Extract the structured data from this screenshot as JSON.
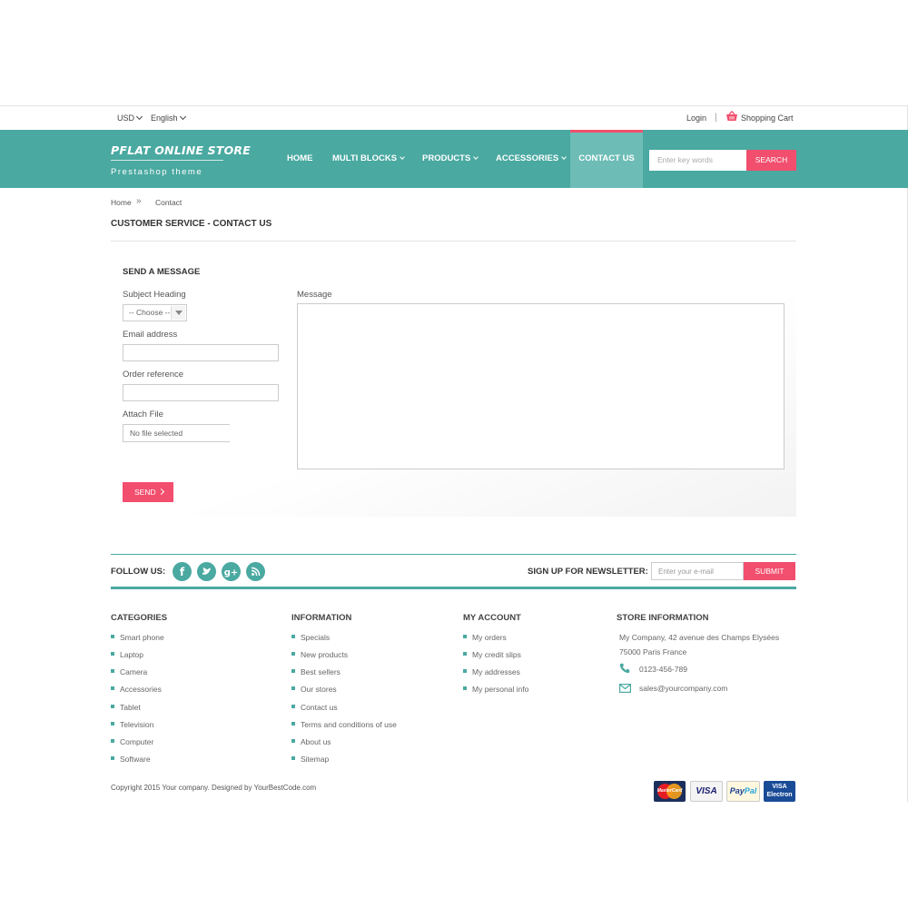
{
  "topbar": {
    "currency": "USD",
    "language": "English",
    "login": "Login",
    "separator": "|",
    "cart": "Shopping Cart"
  },
  "header": {
    "logo_title": "PFLAT ONLINE STORE",
    "logo_subtitle": "Prestashop theme",
    "nav": {
      "home": "HOME",
      "multi_blocks": "MULTI BLOCKS",
      "products": "PRODUCTS",
      "accessories": "ACCESSORIES",
      "contact_us": "CONTACT US"
    },
    "search_placeholder": "Enter key words",
    "search_button": "SEARCH"
  },
  "breadcrumb": {
    "home": "Home",
    "separator": "»",
    "current": "Contact"
  },
  "page_title": "CUSTOMER SERVICE - CONTACT US",
  "form": {
    "title": "SEND A MESSAGE",
    "subject_label": "Subject Heading",
    "subject_value": "-- Choose --",
    "email_label": "Email address",
    "order_label": "Order reference",
    "file_label": "Attach File",
    "file_value": "No file selected",
    "message_label": "Message",
    "send_button": "SEND"
  },
  "follow": {
    "label": "FOLLOW US:",
    "icons": [
      "facebook-icon",
      "twitter-icon",
      "google-plus-icon",
      "rss-icon"
    ],
    "newsletter_label": "SIGN UP FOR NEWSLETTER:",
    "newsletter_placeholder": "Enter your e-mail",
    "newsletter_button": "SUBMIT"
  },
  "footer": {
    "categories": {
      "title": "CATEGORIES",
      "items": [
        "Smart phone",
        "Laptop",
        "Camera",
        "Accessories",
        "Tablet",
        "Television",
        "Computer",
        "Software"
      ]
    },
    "information": {
      "title": "INFORMATION",
      "items": [
        "Specials",
        "New products",
        "Best sellers",
        "Our stores",
        "Contact us",
        "Terms and conditions of use",
        "About us",
        "Sitemap"
      ]
    },
    "account": {
      "title": "MY ACCOUNT",
      "items": [
        "My orders",
        "My credit slips",
        "My addresses",
        "My personal info"
      ]
    },
    "store": {
      "title": "STORE INFORMATION",
      "address_line1": "My Company, 42 avenue des Champs Elysées",
      "address_line2": "75000 Paris France",
      "phone": "0123-456-789",
      "email": "sales@yourcompany.com"
    },
    "copyright": "Copyright 2015 Your company. Designed by YourBestCode.com",
    "payments": {
      "mastercard": "MasterCard",
      "visa": "VISA",
      "paypal_pay": "Pay",
      "paypal_pal": "Pal",
      "visa_electron_1": "VISA",
      "visa_electron_2": "Electron"
    }
  },
  "colors": {
    "teal": "#4aa9a1",
    "teal_active": "#6dbdb6",
    "pink": "#f24e6d"
  }
}
